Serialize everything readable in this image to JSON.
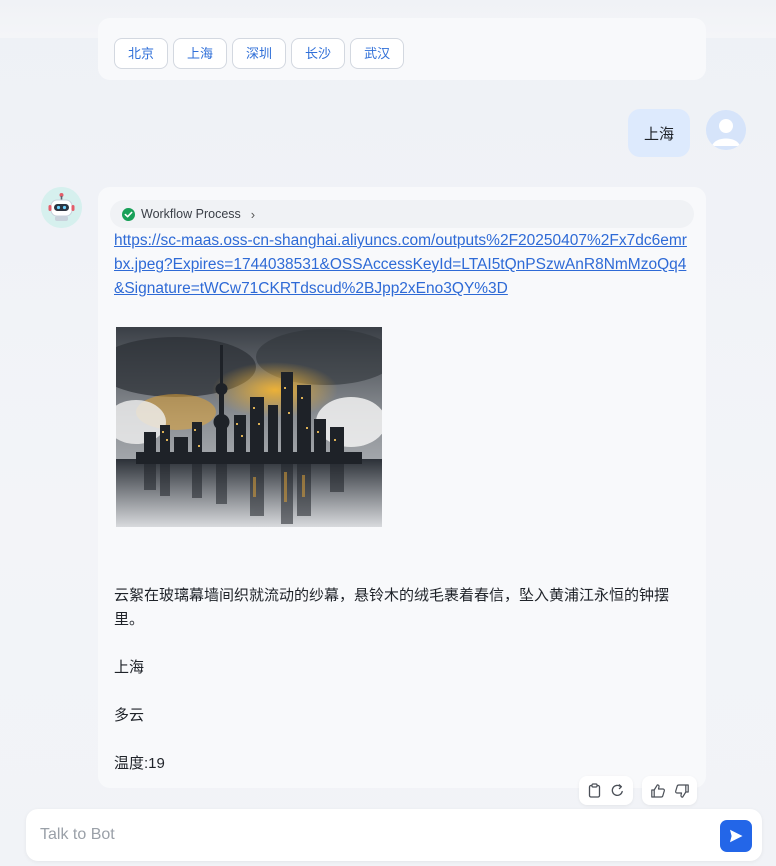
{
  "city_chips": [
    "北京",
    "上海",
    "深圳",
    "长沙",
    "武汉"
  ],
  "user_message": "上海",
  "bot_message": {
    "workflow_label": "Workflow Process",
    "image_link": "https://sc-maas.oss-cn-shanghai.aliyuncs.com/outputs%2F20250407%2Fx7dc6emrbx.jpeg?Expires=1744038531&OSSAccessKeyId=LTAI5tQnPSzwAnR8NmMzoQq4&Signature=tWCw71CKRTdscud%2BJpp2xEno3QY%3D",
    "image_alt": "上海",
    "poem": "云絮在玻璃幕墙间织就流动的纱幕，悬铃木的绒毛裹着春信，坠入黄浦江永恒的钟摆里。",
    "city": "上海",
    "weather": "多云",
    "temperature": "温度:19"
  },
  "actions": {
    "copy_icon": "clipboard-icon",
    "regenerate_icon": "refresh-icon",
    "like_icon": "thumbs-up-icon",
    "dislike_icon": "thumbs-down-icon"
  },
  "input": {
    "placeholder": "Talk to Bot",
    "value": ""
  },
  "colors": {
    "accent": "#2366e8",
    "link": "#2e6ad6",
    "user_bubble": "#ddeafd",
    "success": "#18a058"
  }
}
